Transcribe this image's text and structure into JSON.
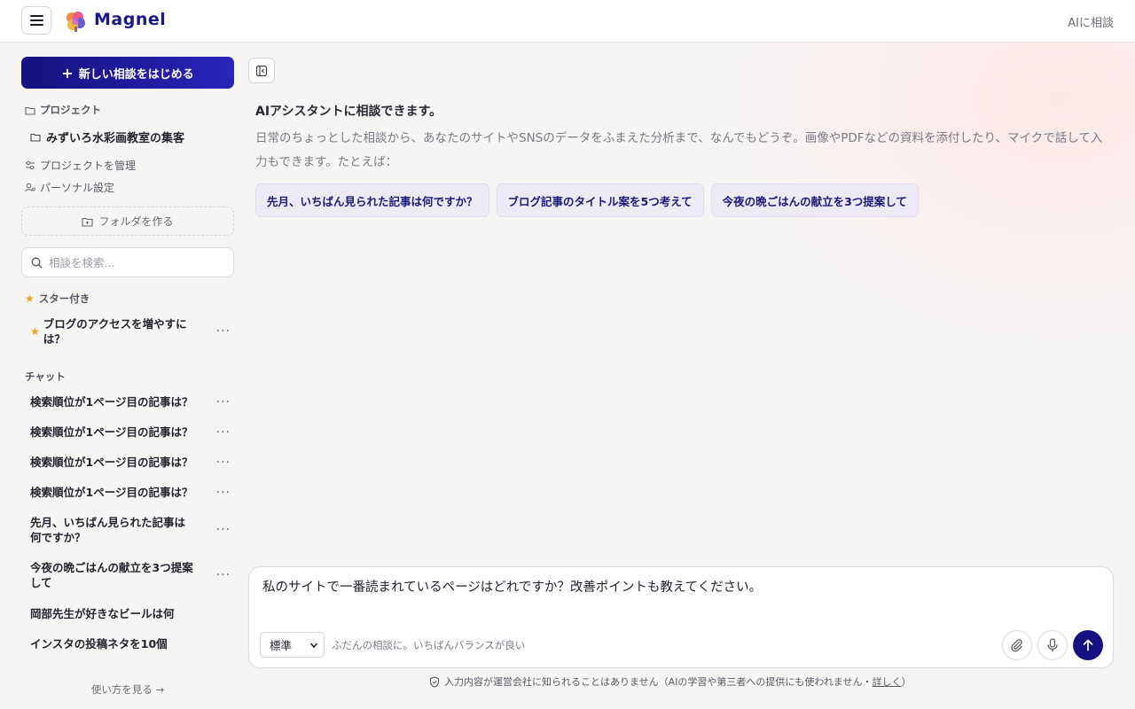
{
  "header": {
    "brand": "Magnel",
    "right_label": "AIに相談"
  },
  "sidebar": {
    "new_button": "新しい相談をはじめる",
    "projects_label": "プロジェクト",
    "project_item": "みずいろ水彩画教室の集客",
    "manage_projects": "プロジェクトを管理",
    "personal_settings": "パーソナル設定",
    "create_folder": "フォルダを作る",
    "search_placeholder": "相談を検索...",
    "starred_label": "スター付き",
    "starred_items": [
      {
        "title": "ブログのアクセスを増やすには？"
      }
    ],
    "chat_label": "チャット",
    "chats": [
      {
        "title": "検索順位が1ページ目の記事は？"
      },
      {
        "title": "検索順位が1ページ目の記事は？"
      },
      {
        "title": "検索順位が1ページ目の記事は？"
      },
      {
        "title": "検索順位が1ページ目の記事は？"
      },
      {
        "title": "先月、いちばん見られた記事は何ですか？"
      },
      {
        "title": "今夜の晩ごはんの献立を3つ提案して"
      },
      {
        "title": "岡部先生が好きなビールは何"
      },
      {
        "title": "インスタの投稿ネタを10個"
      }
    ],
    "more_glyph": "···",
    "how_to": "使い方を見る →"
  },
  "main": {
    "intro_title": "AIアシスタントに相談できます。",
    "intro_desc": "日常のちょっとした相談から、あなたのサイトやSNSのデータをふまえた分析まで、なんでもどうぞ。画像やPDFなどの資料を添付したり、マイクで話して入力もできます。たとえば：",
    "suggestions": [
      "先月、いちばん見られた記事は何ですか？",
      "ブログ記事のタイトル案を5つ考えて",
      "今夜の晩ごはんの献立を3つ提案して"
    ]
  },
  "composer": {
    "value": "私のサイトで一番読まれているページはどれですか？改善ポイントも教えてください。",
    "mode_selected": "標準",
    "mode_hint": "ふだんの相談に。いちばんバランスが良い"
  },
  "privacy": {
    "text": "入力内容が運営会社に知られることはありません（AIの学習や第三者への提供にも使われません・",
    "link": "詳しく",
    "close_paren": "）"
  },
  "colors": {
    "brand": "#1a1690",
    "primary": "#15117f",
    "chip_bg": "#edeaf6",
    "star": "#f0a020"
  }
}
